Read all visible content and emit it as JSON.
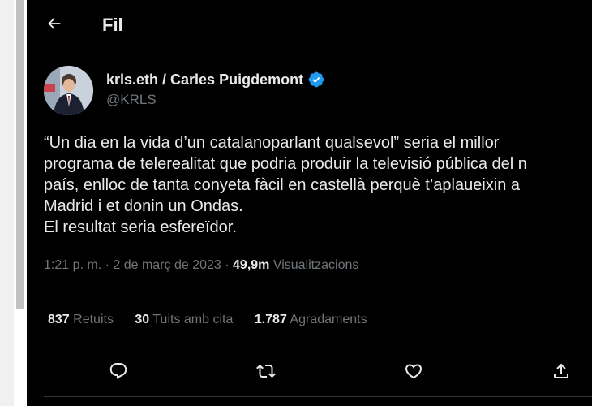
{
  "header": {
    "title": "Fil",
    "back_icon": "arrow-left-icon"
  },
  "author": {
    "name": "krls.eth / Carles Puigdemont",
    "handle": "@KRLS",
    "verified_icon": "verified-badge-icon",
    "verified_color": "#1d9bf0"
  },
  "tweet": {
    "lines": [
      "“Un dia en la vida d’un catalanoparlant qualsevol” seria el millor",
      "programa de telerealitat que podria produir la televisió pública del n",
      "país, enlloc de tanta conyeta fàcil en castellà perquè t’aplaueixin a",
      "Madrid i et donin un Ondas.",
      "El resultat seria esfereïdor."
    ]
  },
  "meta": {
    "time": "1:21 p. m.",
    "separator": " · ",
    "date": "2 de març de 2023",
    "views_count": "49,9m",
    "views_label": " Visualitzacions"
  },
  "stats": {
    "retweets": {
      "count": "837",
      "label": " Retuits"
    },
    "quotes": {
      "count": "30",
      "label": " Tuits amb cita"
    },
    "likes": {
      "count": "1.787",
      "label": " Agradaments"
    }
  },
  "actions": {
    "reply_icon": "reply-icon",
    "retweet_icon": "retweet-icon",
    "like_icon": "heart-icon",
    "share_icon": "share-icon"
  },
  "colors": {
    "background": "#000000",
    "text": "#e7e9ea",
    "secondary": "#71767b",
    "divider": "#2f3336"
  }
}
